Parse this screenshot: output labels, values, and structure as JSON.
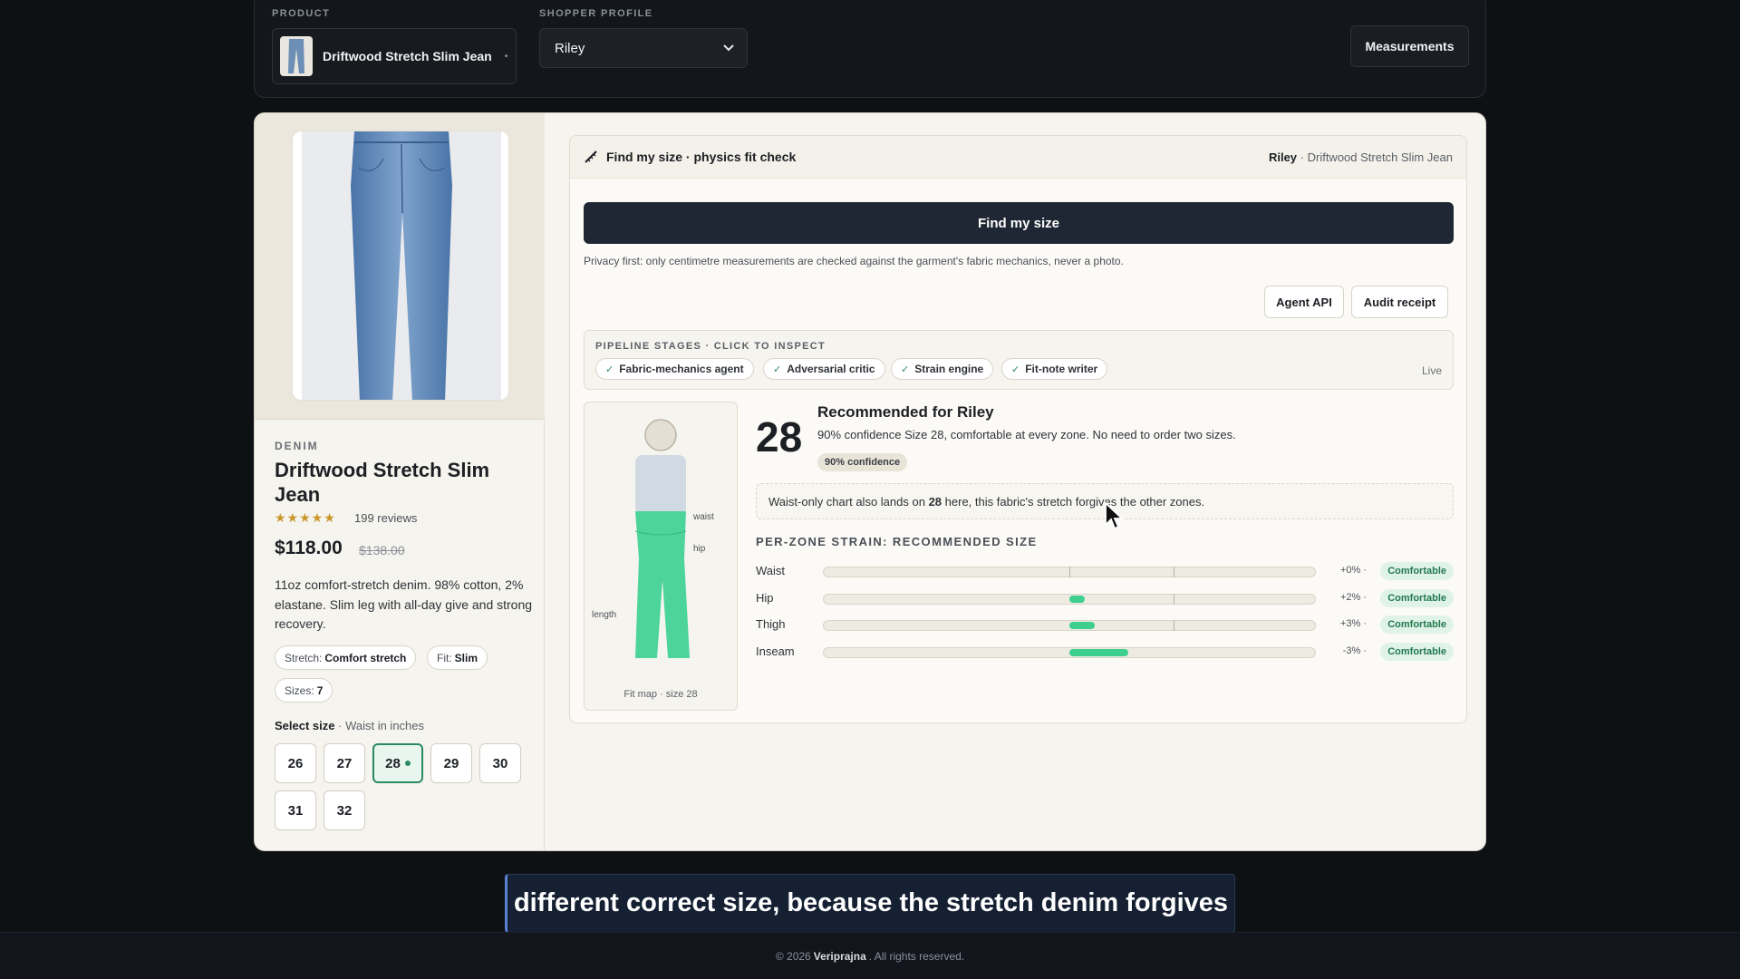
{
  "topbar": {
    "product_label": "PRODUCT",
    "product_name": "Driftwood Stretch Slim Jean",
    "product_dot": "•",
    "profile_label": "SHOPPER PROFILE",
    "profile_value": "Riley",
    "measurements_button": "Measurements"
  },
  "product": {
    "category": "DENIM",
    "title": "Driftwood Stretch Slim Jean",
    "stars": "★★★★★",
    "reviews": "199 reviews",
    "price": "$118.00",
    "old_price": "$138.00",
    "description": "11oz comfort-stretch denim. 98% cotton, 2% elastane. Slim leg with all-day give and strong recovery.",
    "chips": [
      {
        "label": "Stretch:",
        "value": "Comfort stretch"
      },
      {
        "label": "Fit:",
        "value": "Slim"
      },
      {
        "label": "Sizes:",
        "value": "7"
      }
    ],
    "select_label": "Select size",
    "select_sub": "· Waist in inches",
    "sizes": [
      "26",
      "27",
      "28",
      "29",
      "30",
      "31",
      "32"
    ],
    "selected_size": "28"
  },
  "panel": {
    "title": "Find my size · physics fit check",
    "who_name": "Riley",
    "who_product": "· Driftwood Stretch Slim Jean",
    "find_button": "Find my size",
    "privacy": "Privacy first: only centimetre measurements are checked against the garment's fabric mechanics, never a photo.",
    "agent_api": "Agent API",
    "audit_receipt": "Audit receipt",
    "pipeline_label": "PIPELINE STAGES · CLICK TO INSPECT",
    "stages": [
      "Fabric-mechanics agent",
      "Adversarial critic",
      "Strain engine",
      "Fit-note writer"
    ],
    "live": "Live",
    "fit_map_caption": "Fit map · size 28",
    "fit_map_labels": {
      "waist": "waist",
      "hip": "hip",
      "length": "length"
    },
    "big_size": "28",
    "rec_title": "Recommended for Riley",
    "rec_text": "90% confidence Size 28, comfortable at every zone. No need to order two sizes.",
    "confidence_badge": "90% confidence",
    "note_pre": "Waist-only chart also lands on",
    "note_size": "28",
    "note_post": "here, this fabric's stretch forgives the other zones.",
    "strain_title": "PER-ZONE STRAIN: RECOMMENDED SIZE",
    "zones": [
      {
        "name": "Waist",
        "pct": "+0% ·",
        "status": "Comfortable",
        "strain": 0
      },
      {
        "name": "Hip",
        "pct": "+2% ·",
        "status": "Comfortable",
        "strain": 2
      },
      {
        "name": "Thigh",
        "pct": "+3% ·",
        "status": "Comfortable",
        "strain": 3
      },
      {
        "name": "Inseam",
        "pct": "-3% ·",
        "status": "Comfortable",
        "strain": -3
      }
    ]
  },
  "caption": "different correct size, because the stretch denim forgives",
  "footer": {
    "pre": "© 2026",
    "brand": "Veriprajna",
    "post": ". All rights reserved."
  },
  "colors": {
    "accent": "#2a8a62",
    "strain_fill": "#3ecf8e",
    "dark_button": "#1e2733"
  }
}
